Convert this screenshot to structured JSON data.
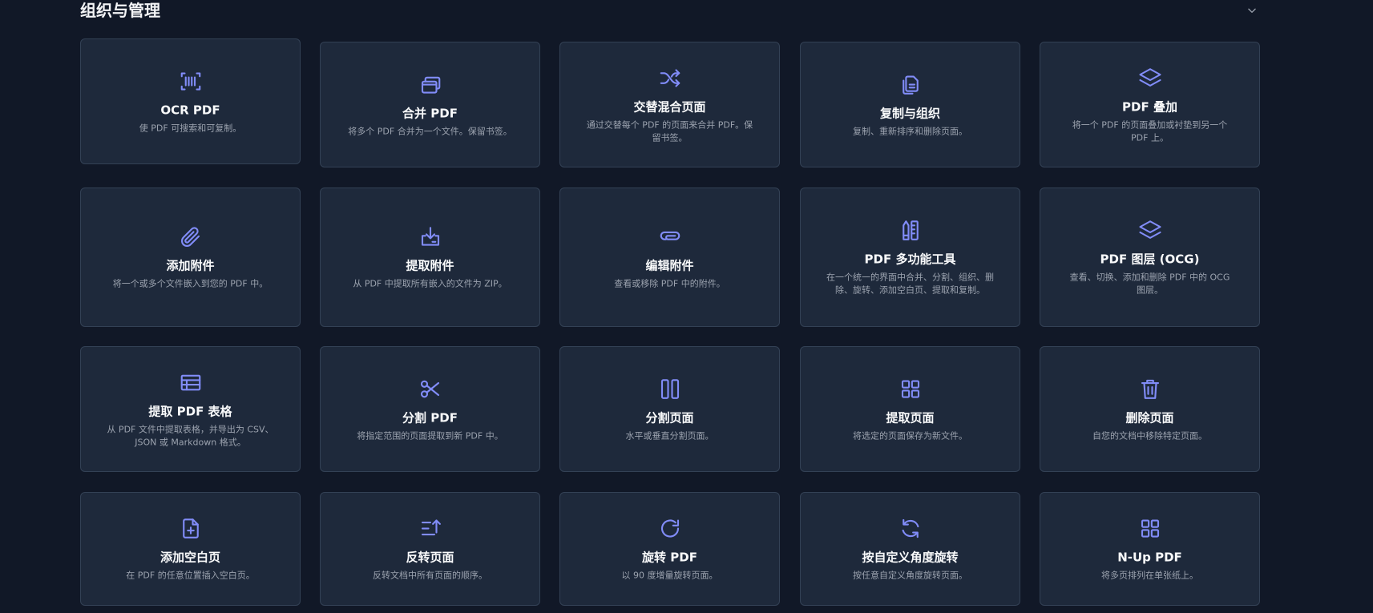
{
  "section": {
    "title": "组织与管理"
  },
  "cards": [
    {
      "title": "OCR PDF",
      "desc": "使 PDF 可搜索和可复制。",
      "icon": "barcode-scan-icon"
    },
    {
      "title": "合并 PDF",
      "desc": "将多个 PDF 合并为一个文件。保留书签。",
      "icon": "stacked-pages-icon"
    },
    {
      "title": "交替混合页面",
      "desc": "通过交替每个 PDF 的页面来合并 PDF。保留书签。",
      "icon": "shuffle-icon"
    },
    {
      "title": "复制与组织",
      "desc": "复制、重新排序和删除页面。",
      "icon": "copy-document-icon"
    },
    {
      "title": "PDF 叠加",
      "desc": "将一个 PDF 的页面叠加或衬垫到另一个 PDF 上。",
      "icon": "layers-icon"
    },
    {
      "title": "添加附件",
      "desc": "将一个或多个文件嵌入到您的 PDF 中。",
      "icon": "paperclip-icon"
    },
    {
      "title": "提取附件",
      "desc": "从 PDF 中提取所有嵌入的文件为 ZIP。",
      "icon": "download-tray-icon"
    },
    {
      "title": "编辑附件",
      "desc": "查看或移除 PDF 中的附件。",
      "icon": "attachment-icon"
    },
    {
      "title": "PDF 多功能工具",
      "desc": "在一个统一的界面中合并、分割、组织、删除、旋转、添加空白页、提取和复制。",
      "icon": "pencil-ruler-icon"
    },
    {
      "title": "PDF 图层 (OCG)",
      "desc": "查看、切换、添加和删除 PDF 中的 OCG 图层。",
      "icon": "layers-icon"
    },
    {
      "title": "提取 PDF 表格",
      "desc": "从 PDF 文件中提取表格，并导出为 CSV、JSON 或 Markdown 格式。",
      "icon": "table-icon"
    },
    {
      "title": "分割 PDF",
      "desc": "将指定范围的页面提取到新 PDF 中。",
      "icon": "scissors-icon"
    },
    {
      "title": "分割页面",
      "desc": "水平或垂直分割页面。",
      "icon": "split-columns-icon"
    },
    {
      "title": "提取页面",
      "desc": "将选定的页面保存为新文件。",
      "icon": "grid-icon"
    },
    {
      "title": "删除页面",
      "desc": "自您的文档中移除特定页面。",
      "icon": "trash-icon"
    },
    {
      "title": "添加空白页",
      "desc": "在 PDF 的任意位置插入空白页。",
      "icon": "file-plus-icon"
    },
    {
      "title": "反转页面",
      "desc": "反转文档中所有页面的顺序。",
      "icon": "sort-reverse-icon"
    },
    {
      "title": "旋转 PDF",
      "desc": "以 90 度增量旋转页面。",
      "icon": "rotate-cw-icon"
    },
    {
      "title": "按自定义角度旋转",
      "desc": "按任意自定义角度旋转页面。",
      "icon": "refresh-icon"
    },
    {
      "title": "N-Up PDF",
      "desc": "将多页排列在单张纸上。",
      "icon": "grid-icon"
    }
  ],
  "colors": {
    "background": "#111827",
    "card": "#1e293b",
    "border": "#334155",
    "accent": "#818cf8"
  }
}
